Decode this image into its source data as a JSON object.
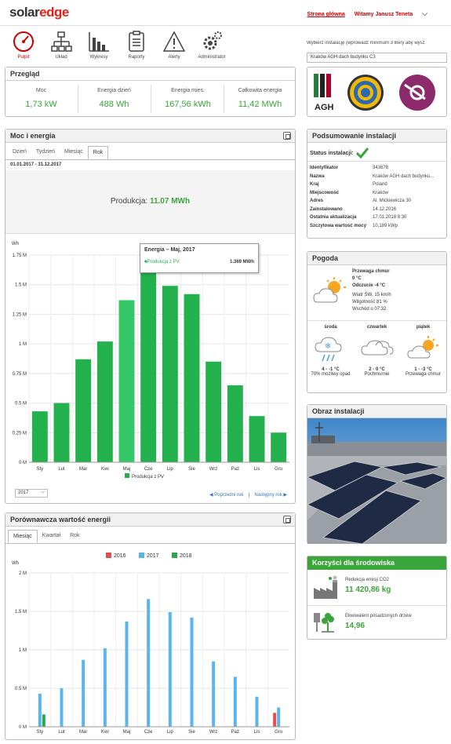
{
  "header": {
    "logo_left": "solar",
    "logo_right": "edge",
    "home_link": "Strona główna",
    "welcome": "Witamy Janusz Teneta"
  },
  "nav": [
    {
      "label": "Pulpit",
      "icon": "dashboard-icon",
      "active": true
    },
    {
      "label": "Układ",
      "icon": "layout-icon"
    },
    {
      "label": "Wykresy",
      "icon": "charts-icon"
    },
    {
      "label": "Raporty",
      "icon": "reports-icon"
    },
    {
      "label": "Alerty",
      "icon": "alert-icon"
    },
    {
      "label": "Administrator",
      "icon": "admin-icon"
    }
  ],
  "site_select": {
    "hint": "Wybierz instalację (wprowadź minimum 3 litery aby wysz",
    "value": "Kraków AGH dach budynku C3"
  },
  "overview": {
    "title": "Przegląd",
    "items": [
      {
        "label": "Moc",
        "value": "1,73 kW"
      },
      {
        "label": "Energia dzień",
        "value": "488 Wh"
      },
      {
        "label": "Energia mies.",
        "value": "167,56 kWh"
      },
      {
        "label": "Całkowita energia",
        "value": "11,42 MWh"
      }
    ]
  },
  "power": {
    "title": "Moc i energia",
    "tabs": [
      "Dzień",
      "Tydzień",
      "Miesiąc",
      "Rok"
    ],
    "active_tab": "Rok",
    "range": "01.01.2017 - 31.12.2017",
    "production_label": "Produkcja:",
    "production_value": "11.07 MWh",
    "tooltip_title": "Energia – Maj, 2017",
    "tooltip_series": "Produkcja z PV",
    "tooltip_value": "1.369 MWh",
    "year": "2017",
    "prev": "◀ Poprzedni rok",
    "sep": "|",
    "next": "Następny rok ▶"
  },
  "summary": {
    "title": "Podsumowanie instalacji",
    "status_label": "Status instalacji:",
    "rows": [
      {
        "k": "Identyfikator",
        "v": "343678"
      },
      {
        "k": "Nazwa",
        "v": "Kraków AGH dach budynku..."
      },
      {
        "k": "Kraj",
        "v": "Poland"
      },
      {
        "k": "Miejscowość",
        "v": "Kraków"
      },
      {
        "k": "Adres",
        "v": "Al. Mickiewicza 30"
      },
      {
        "k": "Zainstalowano",
        "v": "14.12.2016"
      },
      {
        "k": "Ostatnia aktualizacja",
        "v": "17.01.2018 8:30"
      },
      {
        "k": "Szczytowa wartość mocy",
        "v": "10,189 kWp"
      }
    ]
  },
  "weather": {
    "title": "Pogoda",
    "now": {
      "desc": "Przewaga chmur",
      "temp": "0 °C",
      "feel": "Odczucie -4 °C",
      "wind": "Wiatr SW, 15 km/h",
      "humidity": "Wilgotność 81 %",
      "sunrise": "Wschód o 07:32"
    },
    "days": [
      {
        "name": "środa",
        "temp": "4 - -1 °C",
        "desc": "70% możliwy opad"
      },
      {
        "name": "czwartek",
        "temp": "2 - 0 °C",
        "desc": "Pochmurnie"
      },
      {
        "name": "piątek",
        "temp": "1 - -3 °C",
        "desc": "Przewaga chmur"
      }
    ]
  },
  "image_panel": {
    "title": "Obraz instalacji"
  },
  "env": {
    "title": "Korzyści dla środowiska",
    "co2_label": "Redukcja emisji CO2",
    "co2_value": "11 420,86 kg",
    "trees_label": "Ekwiwalent posadzonych drzew",
    "trees_value": "14,96"
  },
  "compare": {
    "title": "Porównawcza wartość energii",
    "tabs": [
      "Miesiąc",
      "Kwartał",
      "Rok"
    ],
    "active_tab": "Miesiąc"
  },
  "chart_data": [
    {
      "type": "bar",
      "ylabel": "Wh",
      "categories": [
        "Sty",
        "Lut",
        "Mar",
        "Kwi",
        "Maj",
        "Cze",
        "Lip",
        "Sie",
        "Wrz",
        "Paź",
        "Lis",
        "Gru"
      ],
      "yticks": [
        "0 M",
        "0.25 M",
        "0.5 M",
        "0.75 M",
        "1 M",
        "1.25 M",
        "1.5 M",
        "1.75 M"
      ],
      "ylim": [
        0,
        1750000
      ],
      "series": [
        {
          "name": "Produkcja z PV",
          "color": "#22b14c",
          "values": [
            430000,
            500000,
            870000,
            1020000,
            1369000,
            1660000,
            1490000,
            1420000,
            850000,
            650000,
            390000,
            250000
          ]
        }
      ]
    },
    {
      "type": "bar",
      "ylabel": "Wh",
      "categories": [
        "Sty",
        "Lut",
        "Mar",
        "Kwi",
        "Maj",
        "Cze",
        "Lip",
        "Sie",
        "Wrz",
        "Paź",
        "Lis",
        "Gru"
      ],
      "yticks": [
        "0 M",
        "0.5 M",
        "1 M",
        "1.5 M",
        "2 M"
      ],
      "ylim": [
        0,
        2000000
      ],
      "series": [
        {
          "name": "2016",
          "color": "#e84c4f",
          "values": [
            0,
            0,
            0,
            0,
            0,
            0,
            0,
            0,
            0,
            0,
            0,
            180000
          ]
        },
        {
          "name": "2017",
          "color": "#5ab4ee",
          "values": [
            430000,
            500000,
            870000,
            1020000,
            1369000,
            1660000,
            1490000,
            1420000,
            850000,
            650000,
            390000,
            250000
          ]
        },
        {
          "name": "2018",
          "color": "#2aa84a",
          "values": [
            160000,
            0,
            0,
            0,
            0,
            0,
            0,
            0,
            0,
            0,
            0,
            0
          ]
        }
      ]
    }
  ]
}
